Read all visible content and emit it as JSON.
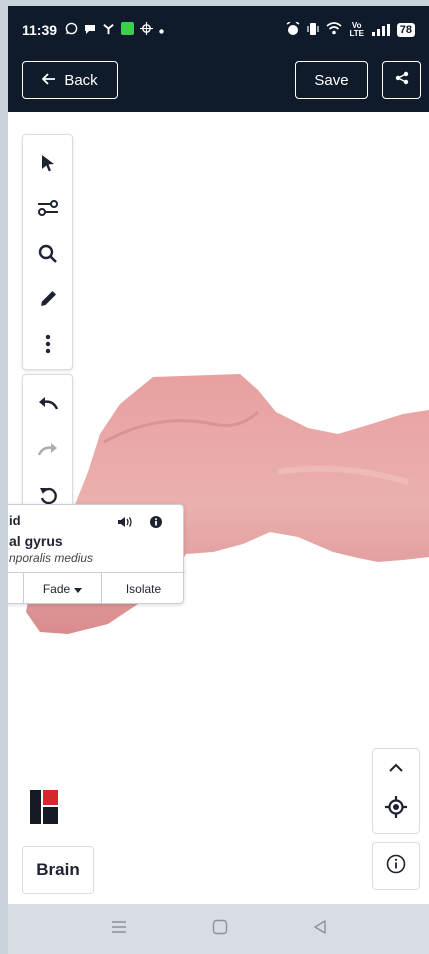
{
  "status_bar": {
    "time": "11:39",
    "icons_left": [
      "whatsapp-icon",
      "message-icon",
      "fan-icon",
      "app-icon",
      "ai-icon",
      "dot-icon"
    ],
    "icons_right": [
      "alarm-icon",
      "vibrate-icon",
      "wifi-icon",
      "volte-icon",
      "signal-icon"
    ],
    "volte": "Vo LTE",
    "battery": "78"
  },
  "header": {
    "back_label": "Back",
    "save_label": "Save",
    "share_icon": "share-icon"
  },
  "toolbar": {
    "tools": [
      "select-arrow-icon",
      "sliders-icon",
      "search-icon",
      "pen-icon",
      "more-vertical-icon"
    ],
    "history": [
      "undo-icon",
      "redo-icon",
      "reset-icon"
    ]
  },
  "popup": {
    "title_fragment": "id",
    "name": "al gyrus",
    "latin": "nporalis medius",
    "fade_label": "Fade",
    "isolate_label": "Isolate"
  },
  "brain_button": {
    "label": "Brain"
  },
  "colors": {
    "header_bg": "#0f1b2b",
    "canvas_bg": "#ffffff",
    "tissue": "#e9a6a6"
  }
}
